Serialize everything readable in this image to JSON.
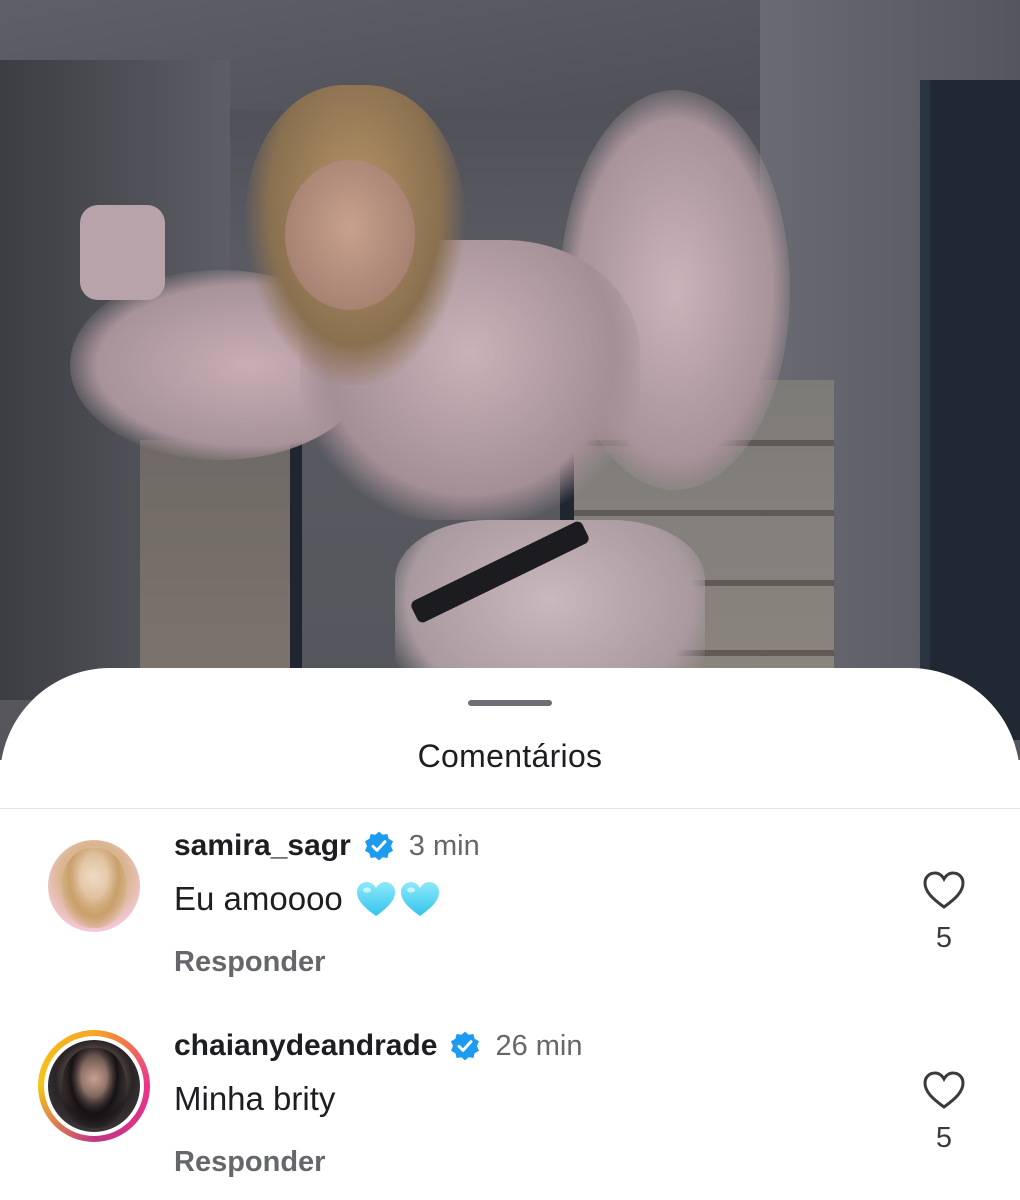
{
  "sheet": {
    "title": "Comentários"
  },
  "comments": [
    {
      "username": "samira_sagr",
      "time": "3 min",
      "text": "Eu amoooo",
      "emoji_count": 2,
      "reply_label": "Responder",
      "likes": "5",
      "avatar_ring": false
    },
    {
      "username": "chaianydeandrade",
      "time": "26 min",
      "text": "Minha brity",
      "emoji_count": 0,
      "reply_label": "Responder",
      "likes": "5",
      "avatar_ring": true
    }
  ],
  "colors": {
    "verified": "#1d9bf0",
    "heart_emoji": "#5fd8f5",
    "secondary_text": "#65676b",
    "primary_text": "#1c1e21"
  },
  "icons": {
    "verified": "verified-badge-icon",
    "like": "heart-outline-icon",
    "emoji": "light-blue-heart-emoji"
  }
}
